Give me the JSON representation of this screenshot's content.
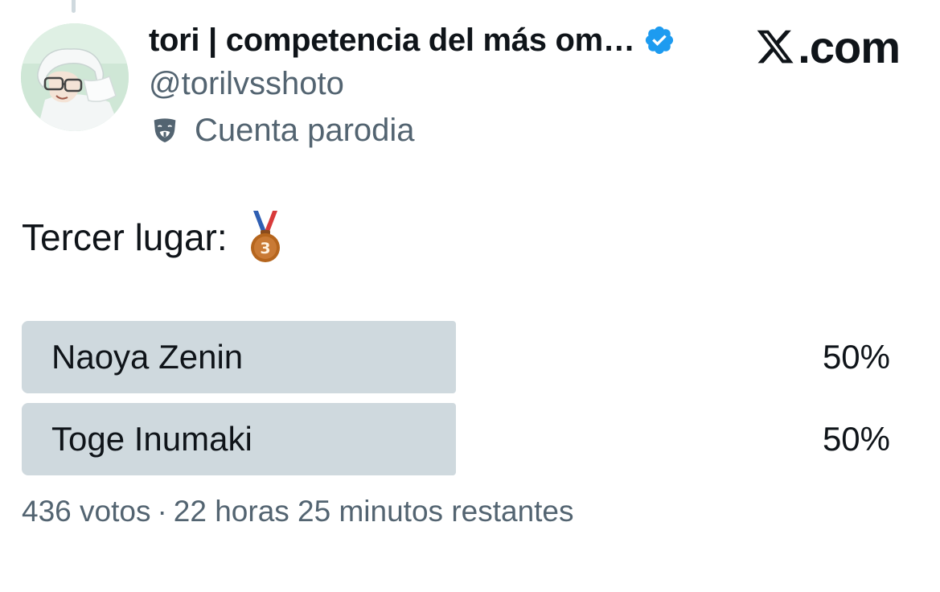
{
  "author": {
    "display_name": "tori | competencia del más om…",
    "handle": "@torilvsshoto",
    "verified": true,
    "account_label": "Cuenta parodia",
    "account_label_icon": "theater-mask-icon",
    "avatar": "avatar-image"
  },
  "brand": {
    "text": ".com",
    "logo_icon": "x-logo-icon"
  },
  "tweet": {
    "text": "Tercer lugar:",
    "emoji_icon": "third-place-medal-icon"
  },
  "poll": {
    "options": [
      {
        "label": "Naoya Zenin",
        "percent_text": "50%",
        "percent": 50
      },
      {
        "label": "Toge Inumaki",
        "percent_text": "50%",
        "percent": 50
      }
    ],
    "votes": "436 votos",
    "separator": "·",
    "time_remaining": "22 horas 25 minutos restantes"
  },
  "colors": {
    "text_primary": "#0f1419",
    "text_secondary": "#536471",
    "poll_bar": "#cfd9de",
    "verified_badge": "#1d9bf0",
    "medal_bronze": "#b5651d"
  }
}
